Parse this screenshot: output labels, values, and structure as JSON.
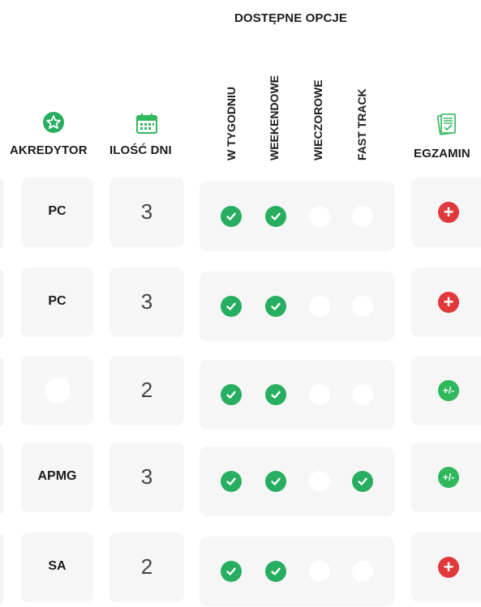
{
  "header": {
    "options_title": "DOSTĘPNE OPCJE",
    "accreditor_title": "AKREDYTOR",
    "days_title": "ILOŚĆ DNI",
    "exam_title": "EGZAMIN",
    "options": [
      "W TYGODNIU",
      "WEEKENDOWE",
      "WIECZOROWE",
      "FAST TRACK"
    ],
    "icons": {
      "accreditor": "star-badge-icon",
      "days": "calendar-icon",
      "exam": "exam-document-icon"
    }
  },
  "colors": {
    "check": "#27ae60",
    "exam_plus": "#e0383b",
    "exam_plus_minus": "#2fb85c",
    "cell_bg": "#f6f6f6"
  },
  "rows": [
    {
      "accreditor": "PC",
      "days": "3",
      "options": [
        true,
        true,
        false,
        false
      ],
      "exam": "plus"
    },
    {
      "accreditor": "PC",
      "days": "3",
      "options": [
        true,
        true,
        false,
        false
      ],
      "exam": "plus"
    },
    {
      "accreditor": "",
      "days": "2",
      "options": [
        true,
        true,
        false,
        false
      ],
      "exam": "plus-minus"
    },
    {
      "accreditor": "APMG",
      "days": "3",
      "options": [
        true,
        true,
        false,
        true
      ],
      "exam": "plus-minus"
    },
    {
      "accreditor": "SA",
      "days": "2",
      "options": [
        true,
        true,
        false,
        false
      ],
      "exam": "plus"
    }
  ]
}
